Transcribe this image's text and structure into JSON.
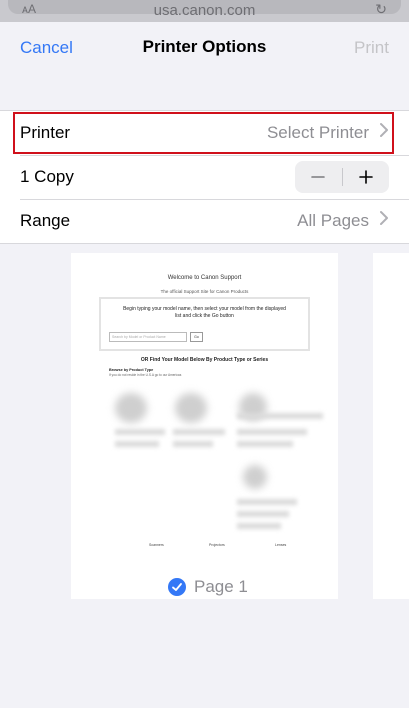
{
  "browser": {
    "url": "usa.canon.com"
  },
  "nav": {
    "cancel_label": "Cancel",
    "title": "Printer Options",
    "print_label": "Print"
  },
  "options": {
    "printer": {
      "label": "Printer",
      "value": "Select Printer"
    },
    "copies": {
      "label": "1 Copy",
      "count": 1
    },
    "range": {
      "label": "Range",
      "value": "All Pages"
    }
  },
  "preview": {
    "page_label": "Page 1",
    "doc": {
      "title": "Welcome to Canon Support",
      "subtitle": "The official Support Site for Canon Products",
      "search_hint": "Begin typing your model name, then select your model from the displayed list and click the Go button",
      "search_placeholder": "Search by Model or Product Name",
      "go_label": "Go",
      "find_text": "OR Find Your Model Below By Product Type or Series",
      "browse_title": "Browse by Product Type",
      "browse_sub": "If you do not reside in the U.S.A go to our Americas",
      "categories": [
        "Scanners",
        "Projectors",
        "Lenses"
      ]
    }
  },
  "colors": {
    "accent": "#3478f6",
    "highlight": "#d0101b"
  }
}
